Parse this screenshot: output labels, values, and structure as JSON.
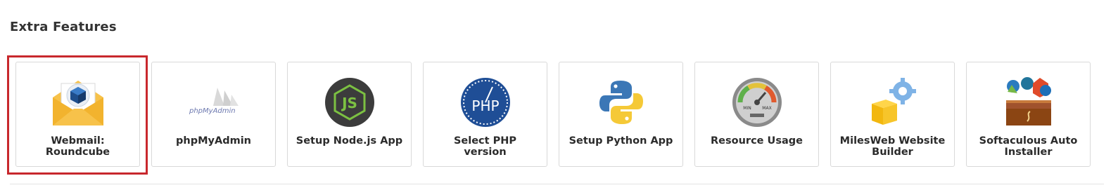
{
  "section": {
    "title": "Extra Features"
  },
  "colors": {
    "highlight": "#c8282d",
    "card_border": "#d9d9d9",
    "label": "#2b2b2b"
  },
  "features": [
    {
      "label_line1": "Webmail:",
      "label_line2": "Roundcube",
      "icon": "webmail-envelope-icon",
      "highlighted": true
    },
    {
      "label_line1": "phpMyAdmin",
      "label_line2": "",
      "icon": "phpmyadmin-logo-icon",
      "logo_text": "phpMyAdmin"
    },
    {
      "label_line1": "Setup Node.js App",
      "label_line2": "",
      "icon": "nodejs-icon",
      "logo_text": "JS"
    },
    {
      "label_line1": "Select PHP",
      "label_line2": "version",
      "icon": "php-gauge-icon",
      "logo_text": "PHP"
    },
    {
      "label_line1": "Setup Python App",
      "label_line2": "",
      "icon": "python-icon"
    },
    {
      "label_line1": "Resource Usage",
      "label_line2": "",
      "icon": "speedometer-icon",
      "gauge_min": "MIN",
      "gauge_max": "MAX"
    },
    {
      "label_line1": "MilesWeb Website",
      "label_line2": "Builder",
      "icon": "box-gear-icon"
    },
    {
      "label_line1": "Softaculous Auto",
      "label_line2": "Installer",
      "icon": "softaculous-chest-icon"
    }
  ]
}
